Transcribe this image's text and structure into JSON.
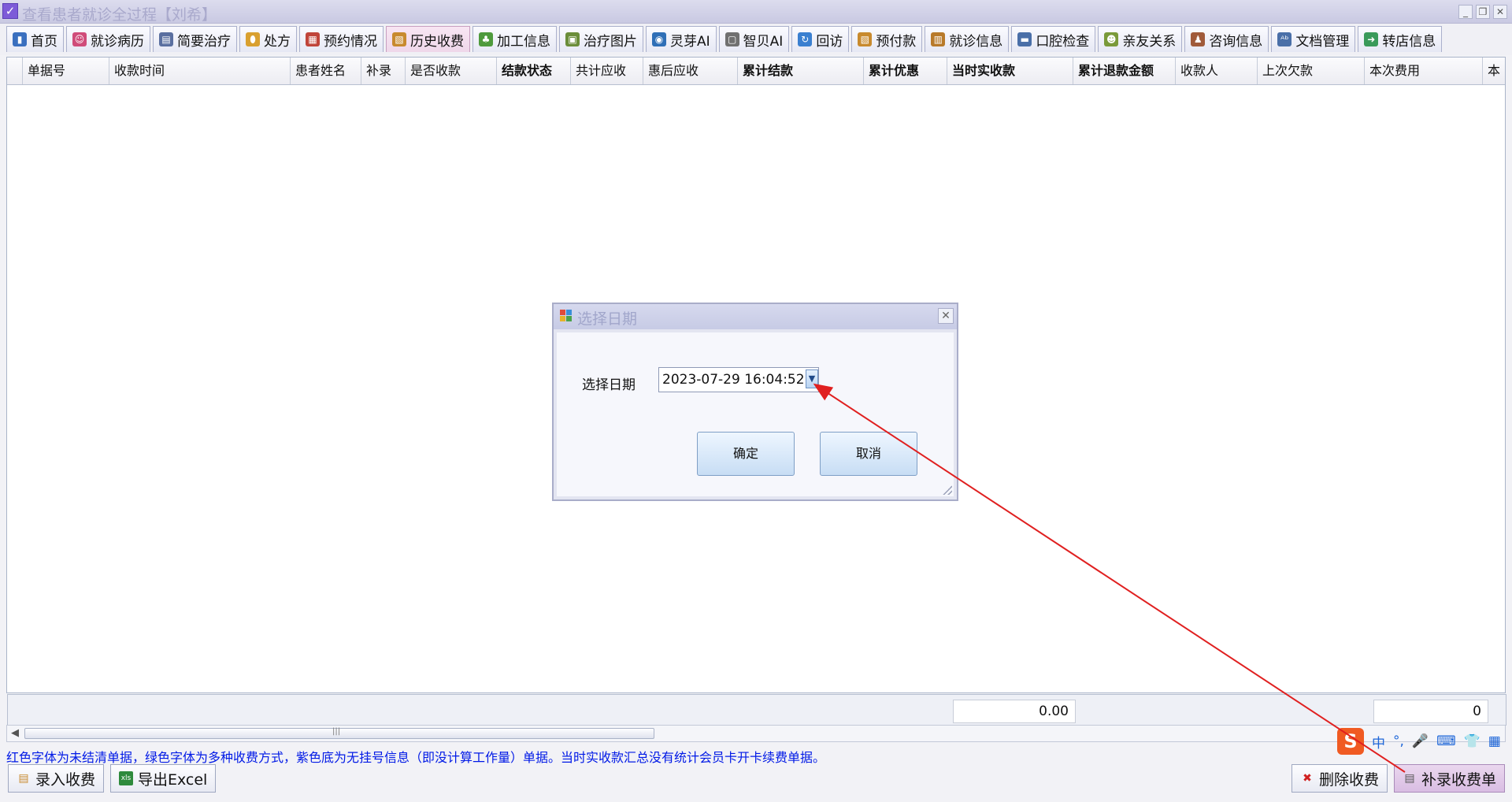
{
  "window": {
    "title": "查看患者就诊全过程【刘希】",
    "controls": [
      "minimize",
      "restore",
      "close"
    ]
  },
  "tabs": [
    {
      "label": "首页",
      "icon": "home-icon",
      "color": "#3a6fbf"
    },
    {
      "label": "就诊病历",
      "icon": "medical-record-icon",
      "color": "#d04c7a"
    },
    {
      "label": "简要治疗",
      "icon": "document-icon",
      "color": "#5a6fa0"
    },
    {
      "label": "处方",
      "icon": "pill-icon",
      "color": "#d9a030"
    },
    {
      "label": "预约情况",
      "icon": "calendar-icon",
      "color": "#c0453a"
    },
    {
      "label": "历史收费",
      "icon": "billing-history-icon",
      "color": "#c88a2e",
      "active": true
    },
    {
      "label": "加工信息",
      "icon": "processing-icon",
      "color": "#4e9a3c"
    },
    {
      "label": "治疗图片",
      "icon": "image-icon",
      "color": "#6b8d3a"
    },
    {
      "label": "灵芽AI",
      "icon": "ai-icon",
      "color": "#2f6fb7"
    },
    {
      "label": "智贝AI",
      "icon": "ai-chat-icon",
      "color": "#707070"
    },
    {
      "label": "回访",
      "icon": "refresh-icon",
      "color": "#3a7fd0"
    },
    {
      "label": "预付款",
      "icon": "prepayment-icon",
      "color": "#c88a2e"
    },
    {
      "label": "就诊信息",
      "icon": "clipboard-icon",
      "color": "#b87a2a"
    },
    {
      "label": "口腔检查",
      "icon": "briefcase-icon",
      "color": "#4a6fa8"
    },
    {
      "label": "亲友关系",
      "icon": "family-icon",
      "color": "#7a9a3a"
    },
    {
      "label": "咨询信息",
      "icon": "consultation-icon",
      "color": "#a05a3a"
    },
    {
      "label": "文档管理",
      "icon": "spellcheck-icon",
      "color": "#4a6fa8"
    },
    {
      "label": "转店信息",
      "icon": "transfer-icon",
      "color": "#3a9a5a"
    }
  ],
  "grid": {
    "columns": [
      {
        "label": "单据号",
        "bold": false
      },
      {
        "label": "收款时间",
        "bold": false
      },
      {
        "label": "患者姓名",
        "bold": false
      },
      {
        "label": "补录",
        "bold": false
      },
      {
        "label": "是否收款",
        "bold": false
      },
      {
        "label": "结款状态",
        "bold": true
      },
      {
        "label": "共计应收",
        "bold": false
      },
      {
        "label": "惠后应收",
        "bold": false
      },
      {
        "label": "累计结款",
        "bold": true
      },
      {
        "label": "累计优惠",
        "bold": true
      },
      {
        "label": "当时实收款",
        "bold": true
      },
      {
        "label": "累计退款金额",
        "bold": true
      },
      {
        "label": "收款人",
        "bold": false
      },
      {
        "label": "上次欠款",
        "bold": false
      },
      {
        "label": "本次费用",
        "bold": false
      },
      {
        "label": "本",
        "bold": false
      }
    ],
    "rows": [],
    "totals": {
      "actual_received": "0.00",
      "current_fee": "0"
    }
  },
  "legend_note": "红色字体为未结清单据，绿色字体为多种收费方式，紫色底为无挂号信息（即没计算工作量）单据。当时实收款汇总没有统计会员卡开卡续费单据。",
  "buttons": {
    "enter_payment": "录入收费",
    "export_excel": "导出Excel",
    "delete_payment": "删除收费",
    "supplement_payment": "补录收费单"
  },
  "ime": {
    "lang": "中",
    "punct": "°,"
  },
  "dialog": {
    "title": "选择日期",
    "label": "选择日期",
    "value": "2023-07-29 16:04:52",
    "ok": "确定",
    "cancel": "取消"
  },
  "colors": {
    "annotation_arrow": "#e02020",
    "legend_text": "#0019e6",
    "active_tab": "#efd7ea"
  }
}
